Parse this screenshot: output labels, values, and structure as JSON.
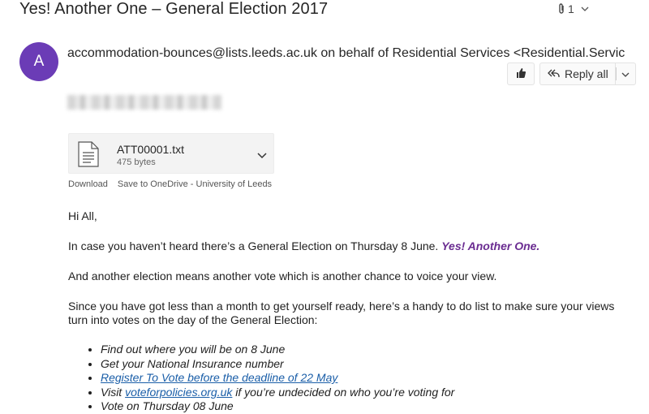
{
  "email": {
    "subject": "Yes! Another One – General Election 2017",
    "attachment_count": "1",
    "sender_avatar_letter": "A",
    "sender_address": "accommodation-bounces@lists.leeds.ac.uk",
    "sender_behalf": "on behalf of",
    "sender_name": "Residential Services <Residential.Servic",
    "actions": {
      "reply_all": "Reply all"
    },
    "attachment": {
      "file_name": "ATT00001.txt",
      "file_size": "475 bytes",
      "download": "Download",
      "save": "Save to OneDrive - University of Leeds"
    },
    "body": {
      "greeting": "Hi All,",
      "para1_text": "In case you haven’t heard there’s a General Election on Thursday 8 June.",
      "para1_emph": "Yes! Another One",
      "para1_end": ".",
      "para2": "And another election means another vote which is another chance to voice your view.",
      "para3": "Since you have got less than a month to get yourself ready, here’s a handy to do list to make sure your views turn into votes on the day of the General Election:",
      "todo": {
        "item1": "Find out where you will be on 8 June",
        "item2": "Get your National Insurance number",
        "item3_link": "Register To Vote before the deadline of 22 May",
        "item4_pre": "Visit ",
        "item4_link": "voteforpolicies.org.uk",
        "item4_post": " if you’re undecided on who you’re voting for",
        "item5": "Vote on Thursday 08 June"
      }
    }
  },
  "icons": [
    "paperclip-icon",
    "chevron-down-icon",
    "thumbs-up-icon",
    "reply-all-icon",
    "file-text-icon"
  ],
  "colors": {
    "avatar": "#6b3cb6",
    "emphasis": "#6a2c91",
    "link": "#1a5ea8"
  }
}
